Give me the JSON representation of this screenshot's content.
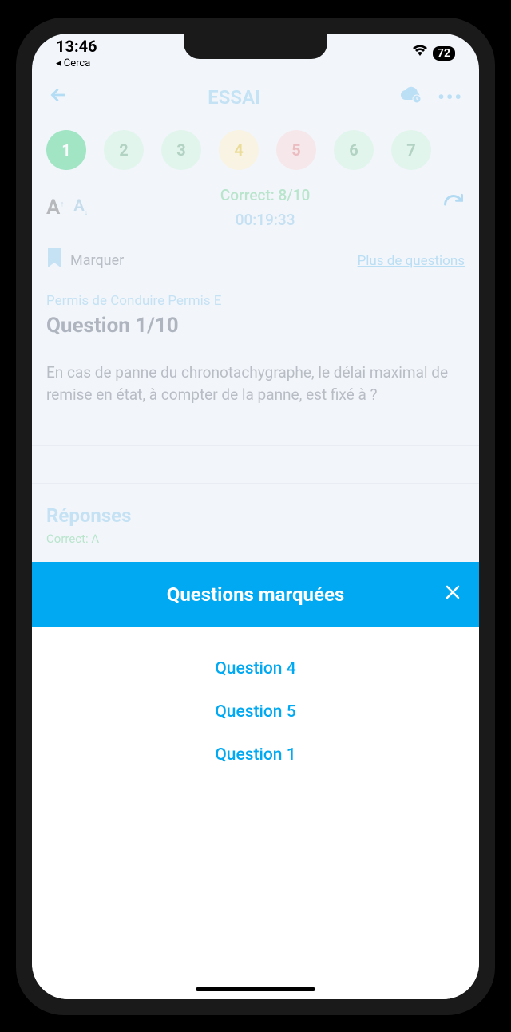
{
  "status": {
    "time": "13:46",
    "back_app": "◂ Cerca",
    "battery": "72"
  },
  "header": {
    "title": "ESSAI"
  },
  "pills": [
    "1",
    "2",
    "3",
    "4",
    "5",
    "6",
    "7"
  ],
  "score": {
    "correct": "Correct: 8/10",
    "timer": "00:19:33"
  },
  "marquer": {
    "label": "Marquer",
    "more_link": "Plus de questions"
  },
  "question": {
    "category": "Permis de Conduire Permis E",
    "number": "Question 1/10",
    "text": "En cas de panne du chronotachygraphe, le délai maximal de remise en état, à compter de la panne, est fixé à ?"
  },
  "answers": {
    "title": "Réponses",
    "correct_label": "Correct: A"
  },
  "sheet": {
    "title": "Questions marquées",
    "items": [
      "Question 4",
      "Question 5",
      "Question 1"
    ]
  }
}
